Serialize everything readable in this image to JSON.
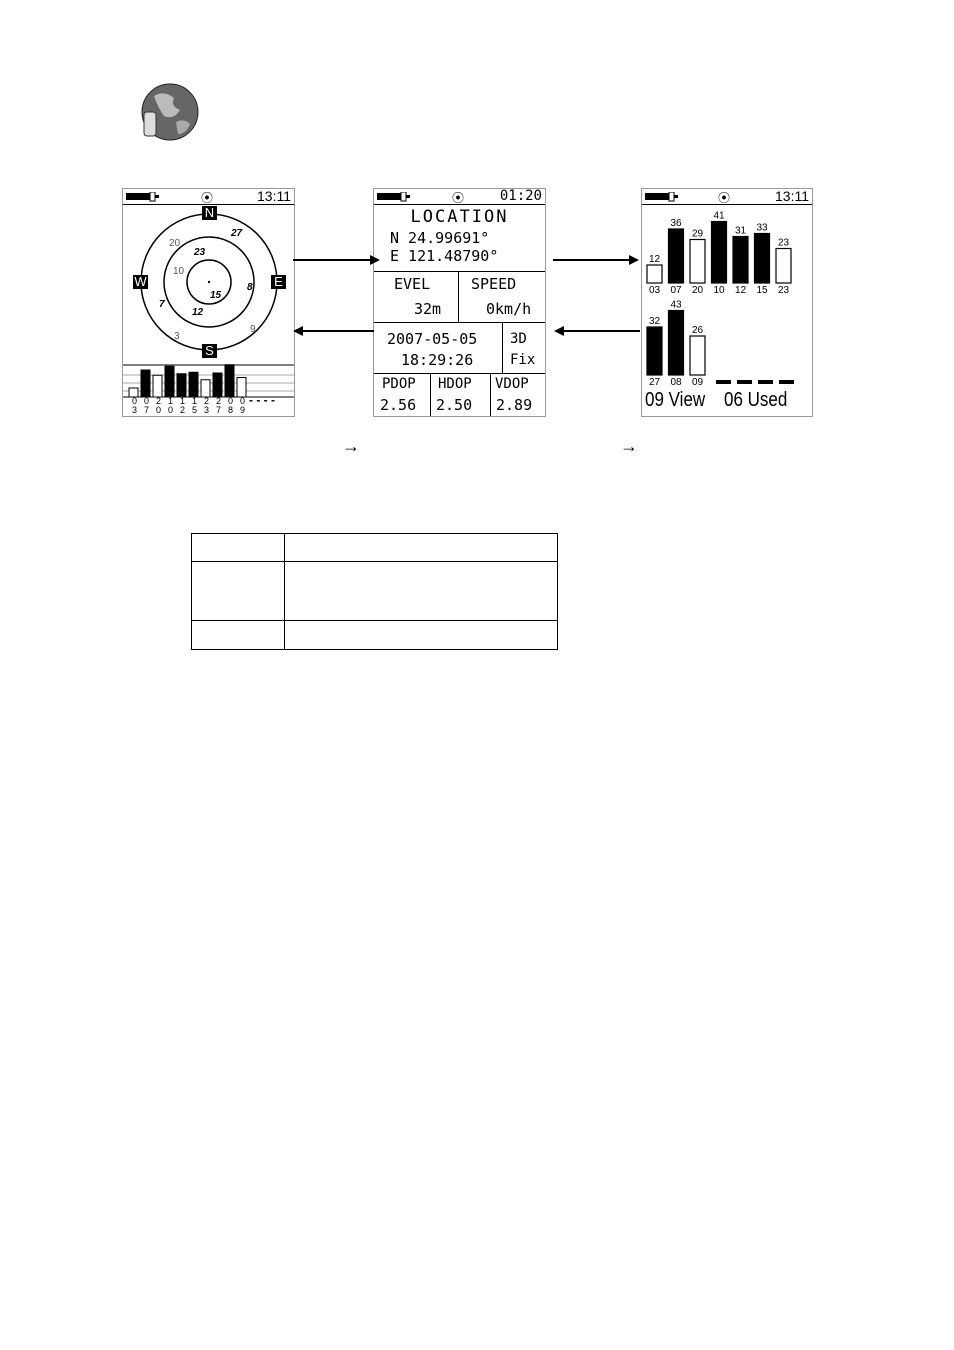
{
  "icons": {
    "app": "globe-gps-icon",
    "battery": "battery-icon",
    "satellite": "satellite-eye-icon"
  },
  "screen1": {
    "time": "13:11",
    "compass": {
      "n": "N",
      "s": "S",
      "e": "E",
      "w": "W"
    },
    "sky_sats": [
      {
        "id": "20",
        "used": false
      },
      {
        "id": "27",
        "used": true
      },
      {
        "id": "23",
        "used": true
      },
      {
        "id": "10",
        "used": false
      },
      {
        "id": "8",
        "used": true
      },
      {
        "id": "15",
        "used": true
      },
      {
        "id": "7",
        "used": true
      },
      {
        "id": "12",
        "used": true
      },
      {
        "id": "3",
        "used": false
      },
      {
        "id": "9",
        "used": false
      }
    ],
    "bar_labels": [
      [
        "0",
        "3"
      ],
      [
        "0",
        "7"
      ],
      [
        "2",
        "0"
      ],
      [
        "1",
        "0"
      ],
      [
        "1",
        "2"
      ],
      [
        "1",
        "5"
      ],
      [
        "2",
        "3"
      ],
      [
        "2",
        "7"
      ],
      [
        "0",
        "8"
      ],
      [
        "0",
        "9"
      ]
    ],
    "empty": "- - - -"
  },
  "screen2": {
    "time": "01:20",
    "title": "LOCATION",
    "lat": "N  24.99691°",
    "lon": "E 121.48790°",
    "elev_label": "EVEL",
    "elev": "32m",
    "speed_label": "SPEED",
    "speed": "0km/h",
    "date": "2007-05-05",
    "clock": "18:29:26",
    "fix1": "3D",
    "fix2": "Fix",
    "pdop_label": "PDOP",
    "pdop": "2.56",
    "hdop_label": "HDOP",
    "hdop": "2.50",
    "vdop_label": "VDOP",
    "vdop": "2.89"
  },
  "screen3": {
    "time": "13:11",
    "view": "09 View",
    "used": "06 Used"
  },
  "chart_data": {
    "type": "bar",
    "title": "",
    "xlabel": "",
    "ylabel": "",
    "categories": [
      "03",
      "07",
      "20",
      "10",
      "12",
      "15",
      "23",
      "27",
      "08",
      "09"
    ],
    "values": [
      12,
      36,
      29,
      41,
      31,
      33,
      23,
      32,
      43,
      26
    ],
    "used": [
      false,
      true,
      false,
      true,
      true,
      true,
      false,
      true,
      true,
      false
    ]
  },
  "arrows": {
    "right": "→",
    "label_arrow": "→"
  },
  "table": {
    "rows": [
      [
        "",
        ""
      ],
      [
        "",
        ""
      ],
      [
        "",
        ""
      ]
    ]
  }
}
